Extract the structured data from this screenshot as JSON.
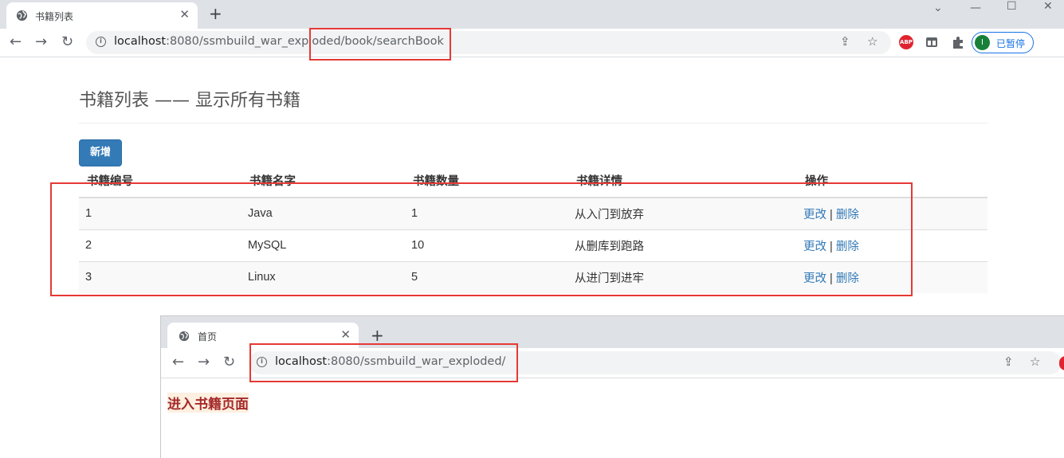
{
  "browser": {
    "tab_title": "书籍列表",
    "url_host": "localhost",
    "url_path": ":8080/ssmbuild_war_exploded/book/searchBook",
    "profile_initial": "I",
    "profile_label": "已暂停",
    "abp_label": "ABP"
  },
  "page": {
    "title": "书籍列表 —— 显示所有书籍",
    "add_button": "新增",
    "columns": [
      "书籍编号",
      "书籍名字",
      "书籍数量",
      "书籍详情",
      "操作"
    ],
    "rows": [
      {
        "id": "1",
        "name": "Java",
        "count": "1",
        "detail": "从入门到放弃"
      },
      {
        "id": "2",
        "name": "MySQL",
        "count": "10",
        "detail": "从删库到跑路"
      },
      {
        "id": "3",
        "name": "Linux",
        "count": "5",
        "detail": "从进门到进牢"
      }
    ],
    "edit_label": "更改",
    "separator": "|",
    "delete_label": "删除"
  },
  "second_window": {
    "tab_title": "首页",
    "url_host": "localhost",
    "url_path": ":8080/ssmbuild_war_exploded/",
    "entry_link": "进入书籍页面"
  },
  "colors": {
    "highlight_box": "#e53935",
    "primary_button": "#337ab7",
    "entry_link": "#a52a2a"
  }
}
